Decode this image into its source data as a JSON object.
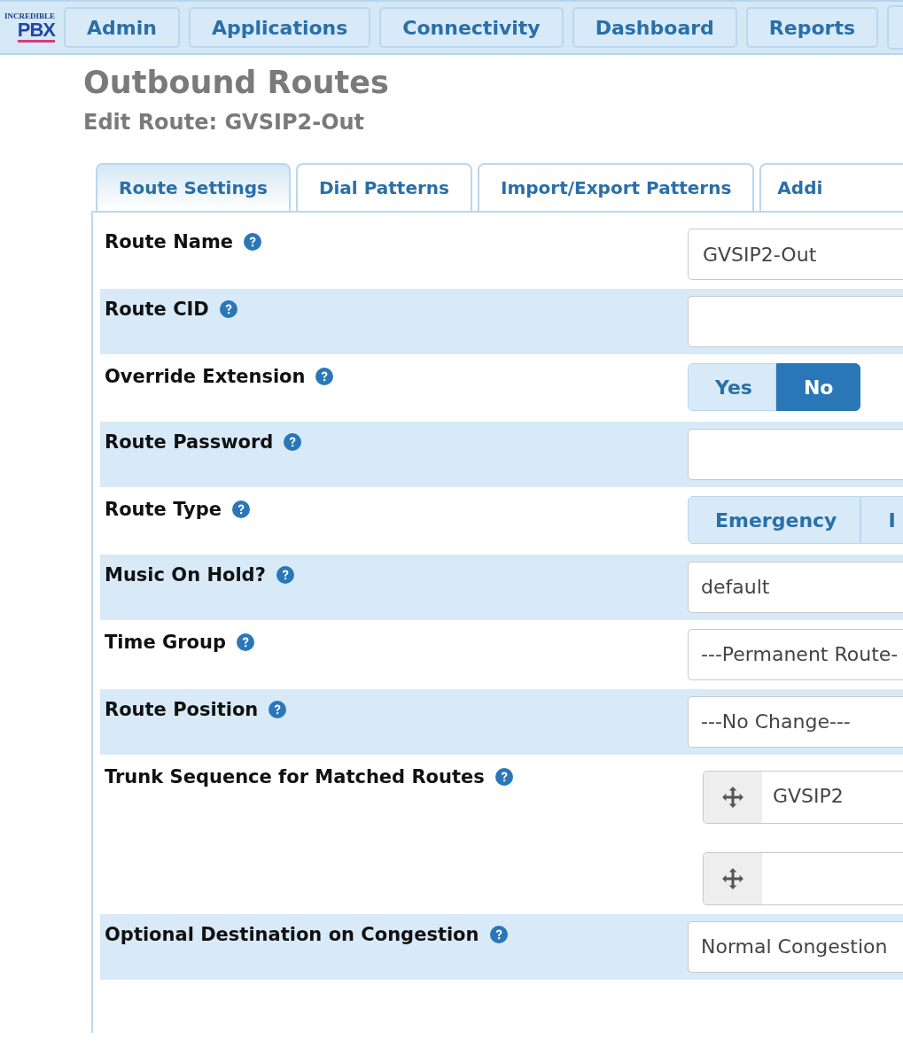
{
  "nav": {
    "logo": {
      "top": "INCREDIBLE",
      "main": "PBX"
    },
    "items": [
      {
        "label": "Admin"
      },
      {
        "label": "Applications"
      },
      {
        "label": "Connectivity"
      },
      {
        "label": "Dashboard"
      },
      {
        "label": "Reports"
      }
    ]
  },
  "page": {
    "title": "Outbound Routes",
    "subtitle": "Edit Route: GVSIP2-Out"
  },
  "tabs": [
    {
      "label": "Route Settings",
      "selected": true
    },
    {
      "label": "Dial Patterns",
      "selected": false
    },
    {
      "label": "Import/Export Patterns",
      "selected": false
    },
    {
      "label": "Addi",
      "selected": false
    }
  ],
  "fields": [
    {
      "kind": "input",
      "label": "Route Name",
      "value": "GVSIP2-Out"
    },
    {
      "kind": "input",
      "label": "Route CID"
    },
    {
      "kind": "toggle",
      "label": "Override Extension",
      "options": [
        {
          "label": "Yes",
          "selected": false
        },
        {
          "label": "No",
          "selected": true
        }
      ]
    },
    {
      "kind": "input",
      "label": "Route Password"
    },
    {
      "kind": "toggle",
      "label": "Route Type",
      "options": [
        {
          "label": "Emergency",
          "selected": false
        },
        {
          "label": "I",
          "selected": false
        }
      ]
    },
    {
      "kind": "select",
      "label": "Music On Hold?",
      "value": "default"
    },
    {
      "kind": "select",
      "label": "Time Group",
      "value": "---Permanent Route-"
    },
    {
      "kind": "select",
      "label": "Route Position",
      "value": "---No Change---"
    },
    {
      "kind": "trunks",
      "label": "Trunk Sequence for Matched Routes",
      "trunks": [
        {
          "value": "GVSIP2"
        },
        {
          "blank": true
        }
      ]
    },
    {
      "kind": "select",
      "label": "Optional Destination on Congestion",
      "value": "Normal Congestion"
    }
  ]
}
